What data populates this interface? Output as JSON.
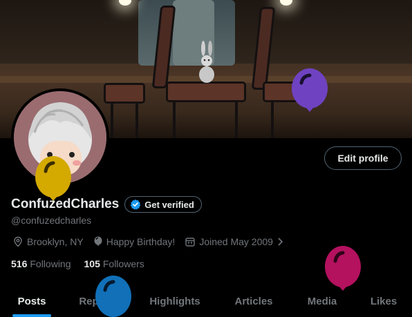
{
  "profile": {
    "display_name": "ConfuzedCharles",
    "verify_label": "Get verified",
    "handle": "@confuzedcharles",
    "location": "Brooklyn, NY",
    "birthday": "Happy Birthday!",
    "joined": "Joined May 2009",
    "following_count": "516",
    "following_label": "Following",
    "followers_count": "105",
    "followers_label": "Followers",
    "edit_label": "Edit profile"
  },
  "tabs": [
    {
      "label": "Posts",
      "active": true
    },
    {
      "label": "Replies",
      "active": false
    },
    {
      "label": "Highlights",
      "active": false
    },
    {
      "label": "Articles",
      "active": false
    },
    {
      "label": "Media",
      "active": false
    },
    {
      "label": "Likes",
      "active": false
    }
  ],
  "balloons": [
    {
      "name": "purple",
      "color": "#6f42c1"
    },
    {
      "name": "yellow",
      "color": "#d4a900"
    },
    {
      "name": "blue",
      "color": "#1170b8"
    },
    {
      "name": "magenta",
      "color": "#b4115f"
    }
  ],
  "colors": {
    "accent": "#1d9bf0",
    "text_primary": "#e7e9ea",
    "text_secondary": "#71767b",
    "border": "#536471",
    "background": "#000000"
  },
  "icons": {
    "location": "location-pin-icon",
    "birthday": "balloon-icon",
    "calendar": "calendar-icon",
    "chevron": "chevron-right-icon",
    "verified": "verified-badge-icon"
  }
}
